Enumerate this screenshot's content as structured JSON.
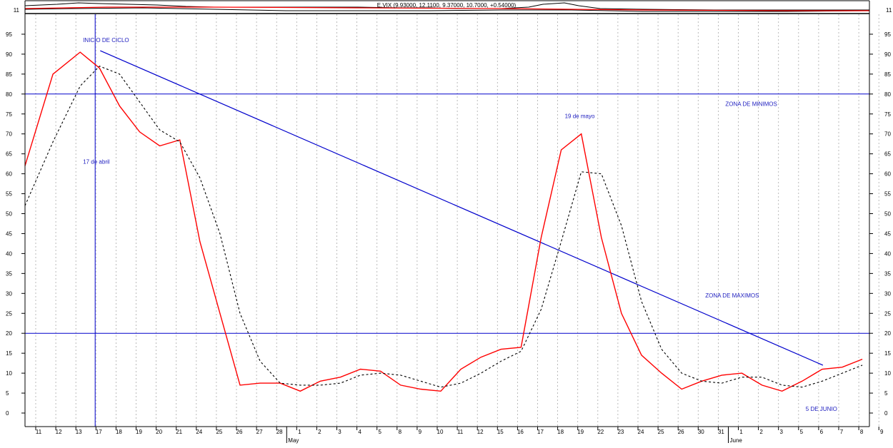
{
  "colors": {
    "background": "#ffffff",
    "stoch_k": "#ff0000",
    "stoch_d": "#000000",
    "lines": "#0000cc",
    "annotation": "#2020c0",
    "grid": "#aaaaaa",
    "frame": "#000000"
  },
  "header": {
    "label": "E.VIX (9.93000, 12.1100, 9.37000, 10.7000, +0.54000)",
    "tick_value": "11"
  },
  "chart_data": {
    "type": "line",
    "title": "",
    "xlabel": "",
    "ylabel": "",
    "ylim": [
      -4,
      97
    ],
    "yticks": [
      0,
      5,
      10,
      15,
      20,
      25,
      30,
      35,
      40,
      45,
      50,
      55,
      60,
      65,
      70,
      75,
      80,
      85,
      90,
      95
    ],
    "x_labels": [
      "11",
      "12",
      "13",
      "17",
      "18",
      "19",
      "20",
      "21",
      "24",
      "25",
      "26",
      "27",
      "28",
      "1",
      "2",
      "3",
      "4",
      "5",
      "8",
      "9",
      "10",
      "11",
      "12",
      "15",
      "16",
      "17",
      "18",
      "19",
      "22",
      "23",
      "24",
      "25",
      "26",
      "30",
      "31",
      "1",
      "2",
      "3",
      "5",
      "6",
      "7",
      "8",
      "9"
    ],
    "month_labels": [
      {
        "label": "May",
        "index": 13
      },
      {
        "label": "June",
        "index": 35
      }
    ],
    "grid": true,
    "series": [
      {
        "values": [
          62,
          85,
          90.5,
          86.5,
          77,
          70.5,
          67,
          68.5,
          43,
          25,
          7,
          7.5,
          7.5,
          5.5,
          8,
          9,
          11,
          10.5,
          7,
          6,
          5.5,
          11,
          14,
          16,
          16.5,
          44,
          66,
          70,
          44,
          25,
          14.5,
          10,
          6,
          8,
          9.5,
          10,
          7,
          5.5,
          8,
          11,
          11.5,
          13.5
        ]
      },
      {
        "values": [
          52,
          68,
          82,
          87,
          85,
          78,
          71,
          68,
          59,
          45,
          25,
          13,
          7.5,
          7,
          7,
          7.5,
          9.5,
          10,
          9.5,
          8,
          6.5,
          7.5,
          10,
          13,
          15.5,
          26,
          43,
          60.5,
          60,
          47,
          28,
          16,
          10,
          8,
          7.5,
          9,
          9,
          7,
          6.5,
          8,
          10,
          12
        ]
      }
    ],
    "reference_lines": [
      {
        "axis": "y",
        "value": 80
      },
      {
        "axis": "y",
        "value": 20
      },
      {
        "axis": "x",
        "index": 2
      }
    ],
    "trendline": {
      "from": {
        "x": "17",
        "y": 90.5
      },
      "to": {
        "x": "6",
        "y": 12
      }
    },
    "annotations": [
      {
        "text": "INICIO DE CICLO",
        "x": "13",
        "y": 93
      },
      {
        "text": "17 de abril",
        "x": "13",
        "y": 62.5
      },
      {
        "text": "19 de mayo",
        "x": "18",
        "y": 74
      },
      {
        "text": "ZONA DE MINIMOS",
        "x": "31",
        "y": 77
      },
      {
        "text": "ZONA DE MAXIMOS",
        "x": "30",
        "y": 29
      },
      {
        "text": "5 DE JUNIO",
        "x": "5",
        "y": 0.5
      }
    ]
  }
}
